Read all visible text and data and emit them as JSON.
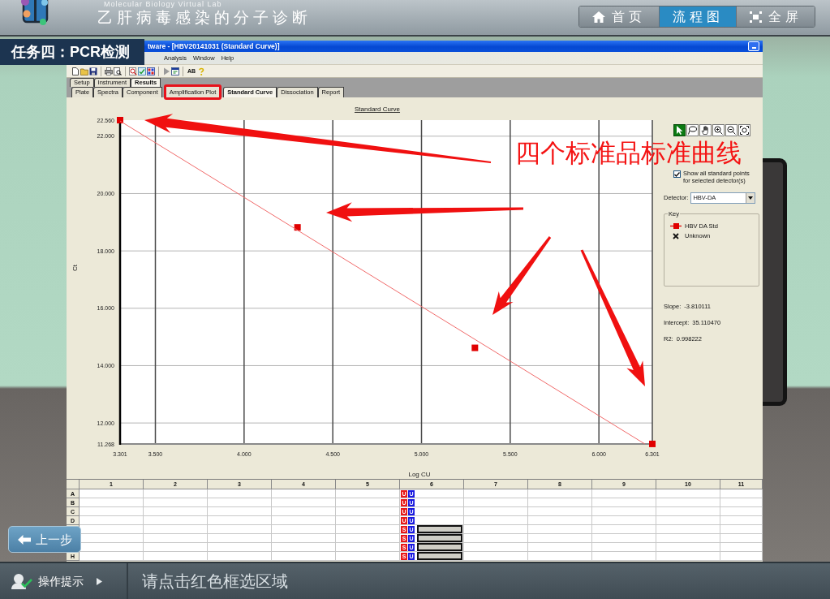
{
  "app_header": {
    "subtitle": "Molecular Biology Virtual Lab",
    "title": "乙肝病毒感染的分子诊断",
    "nav": [
      {
        "kind": "home",
        "label": "首页",
        "selected": false
      },
      {
        "kind": "flow",
        "label": "流程图",
        "selected": true
      },
      {
        "kind": "fullscreen",
        "label": "全屏",
        "selected": false
      }
    ]
  },
  "task_label": "任务四：PCR检测",
  "software_window": {
    "title": "tware - [HBV20141031 (Standard Curve)]",
    "menu": [
      "Analysis",
      "Window",
      "Help"
    ],
    "toolbar": [
      {
        "kind": "new"
      },
      {
        "kind": "open"
      },
      {
        "kind": "save"
      },
      {
        "kind": "separator"
      },
      {
        "kind": "print"
      },
      {
        "kind": "preview"
      },
      {
        "kind": "separator"
      },
      {
        "kind": "find"
      },
      {
        "kind": "edit"
      },
      {
        "kind": "grid"
      },
      {
        "kind": "separator"
      },
      {
        "kind": "run"
      },
      {
        "kind": "window"
      },
      {
        "kind": "separator"
      },
      {
        "kind": "text",
        "label": "AB"
      },
      {
        "kind": "help"
      }
    ],
    "tab_rows": [
      {
        "tabs": [
          {
            "label": "Setup",
            "selected": false,
            "highlighted": false
          },
          {
            "label": "Instrument",
            "selected": false,
            "highlighted": false
          },
          {
            "label": "Results",
            "selected": true,
            "highlighted": false
          }
        ]
      },
      {
        "tabs": [
          {
            "label": "Plate",
            "selected": false,
            "highlighted": false
          },
          {
            "label": "Spectra",
            "selected": false,
            "highlighted": false
          },
          {
            "label": "Component",
            "selected": false,
            "highlighted": false
          },
          {
            "label": "Amplification Plot",
            "selected": false,
            "highlighted": true
          },
          {
            "label": "Standard Curve",
            "selected": true,
            "highlighted": false
          },
          {
            "label": "Dissociation",
            "selected": false,
            "highlighted": false
          },
          {
            "label": "Report",
            "selected": false,
            "highlighted": false
          }
        ]
      }
    ],
    "standard_curve_plot": {
      "chart_data": {
        "type": "scatter",
        "title": "Standard Curve",
        "xlabel": "Log CU",
        "ylabel": "Ct",
        "x": [
          3.301,
          4.301,
          5.301,
          6.301
        ],
        "series": [
          {
            "color": "#e00000",
            "values": [
              22.56,
              18.82,
              14.62,
              11.27
            ]
          }
        ],
        "xlim": [
          3.301,
          6.301
        ],
        "ylim": [
          11.268,
          22.56
        ],
        "grid": true,
        "xticks": [
          {
            "value": 3.301,
            "label": "3.301"
          },
          {
            "value": 3.5,
            "label": "3.500"
          },
          {
            "value": 4,
            "label": "4.000"
          },
          {
            "value": 4.5,
            "label": "4.500"
          },
          {
            "value": 5,
            "label": "5.000"
          },
          {
            "value": 5.5,
            "label": "5.500"
          },
          {
            "value": 6,
            "label": "6.000"
          },
          {
            "value": 6.301,
            "label": "6.301"
          }
        ],
        "yticks": [
          {
            "value": 11.268,
            "label": "11.268"
          },
          {
            "value": 12,
            "label": "12.000"
          },
          {
            "value": 14,
            "label": "14.000"
          },
          {
            "value": 16,
            "label": "16.000"
          },
          {
            "value": 18,
            "label": "18.000"
          },
          {
            "value": 20,
            "label": "20.000"
          },
          {
            "value": 22,
            "label": "22.000"
          },
          {
            "value": 22.56,
            "label": "22.560"
          }
        ]
      }
    },
    "side_panel": {
      "tools": [
        {
          "kind": "pointer",
          "selected": true
        },
        {
          "kind": "lasso",
          "selected": false
        },
        {
          "kind": "hand",
          "selected": false
        },
        {
          "kind": "zoom_in",
          "selected": false
        },
        {
          "kind": "zoom_out",
          "selected": false
        },
        {
          "kind": "zoom_fit",
          "selected": false
        }
      ],
      "show_all_points": {
        "label": "Show all standard points for selected detector(s)",
        "checked": true
      },
      "detector": {
        "label": "Detector:",
        "value": "HBV-DA"
      },
      "key": {
        "title": "Key",
        "entries": [
          {
            "kind": "standard",
            "label": "HBV DA Std"
          },
          {
            "kind": "unknown",
            "label": "Unknown"
          }
        ]
      },
      "stats": [
        {
          "label": "Slope:",
          "value": "-3.810111"
        },
        {
          "label": "Intercept:",
          "value": "35.110470"
        },
        {
          "label": "R2:",
          "value": "0.998222"
        }
      ]
    },
    "plate": {
      "columns": [
        "1",
        "2",
        "3",
        "4",
        "5",
        "6",
        "7",
        "8",
        "9",
        "10",
        "11"
      ],
      "rows": [
        {
          "label": "A",
          "tags": [
            {
              "text": "U",
              "color": "#e81818"
            },
            {
              "text": "U",
              "color": "#1a1ae0"
            }
          ],
          "selected": false
        },
        {
          "label": "B",
          "tags": [
            {
              "text": "U",
              "color": "#e81818"
            },
            {
              "text": "U",
              "color": "#1a1ae0"
            }
          ],
          "selected": false
        },
        {
          "label": "C",
          "tags": [
            {
              "text": "U",
              "color": "#e81818"
            },
            {
              "text": "U",
              "color": "#1a1ae0"
            }
          ],
          "selected": false
        },
        {
          "label": "D",
          "tags": [
            {
              "text": "U",
              "color": "#e81818"
            },
            {
              "text": "U",
              "color": "#1a1ae0"
            }
          ],
          "selected": false
        },
        {
          "tags": [
            {
              "text": "S",
              "color": "#e81818"
            },
            {
              "text": "U",
              "color": "#1a1ae0"
            }
          ],
          "selected": true
        },
        {
          "tags": [
            {
              "text": "S",
              "color": "#e81818"
            },
            {
              "text": "U",
              "color": "#1a1ae0"
            }
          ],
          "selected": true
        },
        {
          "tags": [
            {
              "text": "S",
              "color": "#e81818"
            },
            {
              "text": "U",
              "color": "#1a1ae0"
            }
          ],
          "selected": true
        },
        {
          "label": "H",
          "tags": [
            {
              "text": "S",
              "color": "#e81818"
            },
            {
              "text": "U",
              "color": "#1a1ae0"
            }
          ],
          "selected": true
        }
      ]
    }
  },
  "annotation": {
    "text": "四个标准品标准曲线"
  },
  "back_button": {
    "label": "上一步"
  },
  "hint_bar": {
    "label": "操作提示",
    "message": "请点击红色框选区域"
  }
}
